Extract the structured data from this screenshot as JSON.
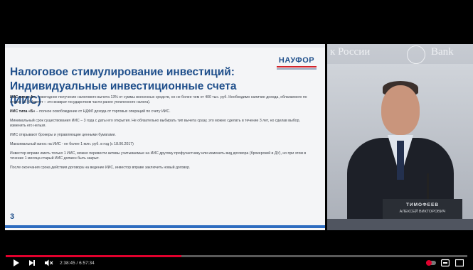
{
  "slide": {
    "title_line1": "Налоговое стимулирование инвестиций:",
    "title_line2": "Индивидуальные инвестиционные счета (ИИС)",
    "logo": "НАУФОР",
    "p1_bold": "ИИС типа «А»",
    "p1_text": " – ежегодное получение налогового вычета 13% от суммы внесенных средств, но не более чем от 400 тыс. руб. Необходимо наличие дохода, облагаемого по ставке 13 % (вычет – это возврат государством части ранее уплаченного налога).",
    "p2_bold": "ИИС типа «Б»",
    "p2_text": " – полное освобождение от НДФЛ дохода от торговых операций по счету ИИС.",
    "p3": "Минимальный срок существования ИИС – 3 года с даты его открытия. Не обязательно выбирать тип вычета сразу, это можно сделать в течение 3 лет, но сделав выбор, изменить его нельзя.",
    "p4": "ИИС открывают брокеры и управляющие ценными бумагами.",
    "p5": "Максимальный взнос на ИИС - не более 1 млн. руб. в год (с 18.06.2017)",
    "p6": "Инвестор вправе иметь только 1 ИИС, можно перевести активы учитываемые на ИИС другому профучастнику или изменить вид договора (брокерский и ДУ), но при этом в течение 1 месяца старый ИИС должен быть закрыт.",
    "p7": "После окончания срока действия договора на ведение ИИС, инвестор вправе заключить новый договор.",
    "page_number": "3"
  },
  "camera": {
    "bank_left": "к России",
    "bank_right": "Bank",
    "nameplate_name": "ТИМОФЕЕВ",
    "nameplate_sub": "АЛЕКСЕЙ ВИКТОРОВИЧ"
  },
  "controls": {
    "time": "2:38:45 / 6:57:34",
    "progress_fraction": 0.38,
    "accent": "#e1002d",
    "icons": [
      "play-icon",
      "next-icon",
      "volume-mute-icon",
      "autoplay-icon",
      "subtitles-icon",
      "settings-icon"
    ]
  }
}
